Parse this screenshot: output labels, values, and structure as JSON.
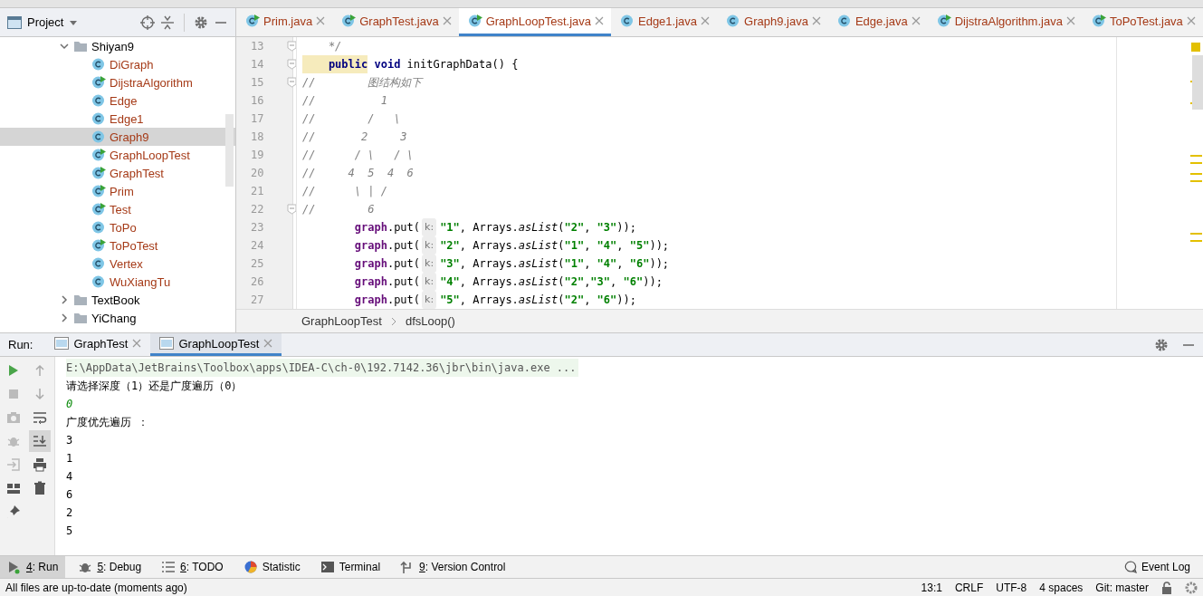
{
  "project_panel": {
    "title": "Project",
    "tree": [
      {
        "label": "Shiyan9",
        "kind": "folder",
        "expanded": true,
        "children": [
          {
            "label": "DiGraph",
            "kind": "class",
            "runnable": false,
            "selected": false
          },
          {
            "label": "DijstraAlgorithm",
            "kind": "class",
            "runnable": true,
            "selected": false
          },
          {
            "label": "Edge",
            "kind": "class",
            "runnable": false,
            "selected": false
          },
          {
            "label": "Edge1",
            "kind": "class",
            "runnable": false,
            "selected": false
          },
          {
            "label": "Graph9",
            "kind": "class",
            "runnable": false,
            "selected": true
          },
          {
            "label": "GraphLoopTest",
            "kind": "class",
            "runnable": true,
            "selected": false
          },
          {
            "label": "GraphTest",
            "kind": "class",
            "runnable": true,
            "selected": false
          },
          {
            "label": "Prim",
            "kind": "class",
            "runnable": true,
            "selected": false
          },
          {
            "label": "Test",
            "kind": "class",
            "runnable": true,
            "selected": false
          },
          {
            "label": "ToPo",
            "kind": "class",
            "runnable": false,
            "selected": false
          },
          {
            "label": "ToPoTest",
            "kind": "class",
            "runnable": true,
            "selected": false
          },
          {
            "label": "Vertex",
            "kind": "class",
            "runnable": false,
            "selected": false
          },
          {
            "label": "WuXiangTu",
            "kind": "class",
            "runnable": false,
            "selected": false
          }
        ]
      },
      {
        "label": "TextBook",
        "kind": "folder",
        "expanded": false
      },
      {
        "label": "YiChang",
        "kind": "folder",
        "expanded": false
      }
    ]
  },
  "editor": {
    "tabs": [
      {
        "label": "Prim.java",
        "runnable": true,
        "selected": false
      },
      {
        "label": "GraphTest.java",
        "runnable": true,
        "selected": false
      },
      {
        "label": "GraphLoopTest.java",
        "runnable": true,
        "selected": true
      },
      {
        "label": "Edge1.java",
        "runnable": false,
        "selected": false
      },
      {
        "label": "Graph9.java",
        "runnable": false,
        "selected": false
      },
      {
        "label": "Edge.java",
        "runnable": false,
        "selected": false
      },
      {
        "label": "DijstraAlgorithm.java",
        "runnable": true,
        "selected": false
      },
      {
        "label": "ToPoTest.java",
        "runnable": true,
        "selected": false
      }
    ],
    "lines": [
      {
        "number": "13",
        "fold": true,
        "tokens": [
          {
            "kind": "comment",
            "text": "    */"
          }
        ]
      },
      {
        "number": "14",
        "fold": true,
        "tokens": [
          {
            "kind": "keyword-highlight",
            "text": "    public"
          },
          {
            "kind": "keyword",
            "text": " void"
          },
          {
            "kind": "plain",
            "text": " initGraphData() {"
          }
        ]
      },
      {
        "number": "15",
        "fold": true,
        "tokens": [
          {
            "kind": "comment",
            "text": "//        图结构如下"
          }
        ]
      },
      {
        "number": "16",
        "fold": false,
        "tokens": [
          {
            "kind": "comment",
            "text": "//          1"
          }
        ]
      },
      {
        "number": "17",
        "fold": false,
        "tokens": [
          {
            "kind": "comment",
            "text": "//        /   \\"
          }
        ]
      },
      {
        "number": "18",
        "fold": false,
        "tokens": [
          {
            "kind": "comment",
            "text": "//       2     3"
          }
        ]
      },
      {
        "number": "19",
        "fold": false,
        "tokens": [
          {
            "kind": "comment",
            "text": "//      / \\   / \\"
          }
        ]
      },
      {
        "number": "20",
        "fold": false,
        "tokens": [
          {
            "kind": "comment",
            "text": "//     4  5  4  6"
          }
        ]
      },
      {
        "number": "21",
        "fold": false,
        "tokens": [
          {
            "kind": "comment",
            "text": "//      \\ | /"
          }
        ]
      },
      {
        "number": "22",
        "fold": true,
        "tokens": [
          {
            "kind": "comment",
            "text": "//        6"
          }
        ]
      },
      {
        "number": "23",
        "fold": false,
        "tokens": [
          {
            "kind": "field",
            "text": "        graph"
          },
          {
            "kind": "plain",
            "text": ".put("
          },
          {
            "kind": "hint",
            "text": "k:"
          },
          {
            "kind": "string",
            "text": "\"1\""
          },
          {
            "kind": "plain",
            "text": ", Arrays."
          },
          {
            "kind": "static",
            "text": "asList"
          },
          {
            "kind": "plain",
            "text": "("
          },
          {
            "kind": "string",
            "text": "\"2\""
          },
          {
            "kind": "plain",
            "text": ", "
          },
          {
            "kind": "string",
            "text": "\"3\""
          },
          {
            "kind": "plain",
            "text": "));"
          }
        ]
      },
      {
        "number": "24",
        "fold": false,
        "tokens": [
          {
            "kind": "field",
            "text": "        graph"
          },
          {
            "kind": "plain",
            "text": ".put("
          },
          {
            "kind": "hint",
            "text": "k:"
          },
          {
            "kind": "string",
            "text": "\"2\""
          },
          {
            "kind": "plain",
            "text": ", Arrays."
          },
          {
            "kind": "static",
            "text": "asList"
          },
          {
            "kind": "plain",
            "text": "("
          },
          {
            "kind": "string",
            "text": "\"1\""
          },
          {
            "kind": "plain",
            "text": ", "
          },
          {
            "kind": "string",
            "text": "\"4\""
          },
          {
            "kind": "plain",
            "text": ", "
          },
          {
            "kind": "string",
            "text": "\"5\""
          },
          {
            "kind": "plain",
            "text": "));"
          }
        ]
      },
      {
        "number": "25",
        "fold": false,
        "tokens": [
          {
            "kind": "field",
            "text": "        graph"
          },
          {
            "kind": "plain",
            "text": ".put("
          },
          {
            "kind": "hint",
            "text": "k:"
          },
          {
            "kind": "string",
            "text": "\"3\""
          },
          {
            "kind": "plain",
            "text": ", Arrays."
          },
          {
            "kind": "static",
            "text": "asList"
          },
          {
            "kind": "plain",
            "text": "("
          },
          {
            "kind": "string",
            "text": "\"1\""
          },
          {
            "kind": "plain",
            "text": ", "
          },
          {
            "kind": "string",
            "text": "\"4\""
          },
          {
            "kind": "plain",
            "text": ", "
          },
          {
            "kind": "string",
            "text": "\"6\""
          },
          {
            "kind": "plain",
            "text": "));"
          }
        ]
      },
      {
        "number": "26",
        "fold": false,
        "tokens": [
          {
            "kind": "field",
            "text": "        graph"
          },
          {
            "kind": "plain",
            "text": ".put("
          },
          {
            "kind": "hint",
            "text": "k:"
          },
          {
            "kind": "string",
            "text": "\"4\""
          },
          {
            "kind": "plain",
            "text": ", Arrays."
          },
          {
            "kind": "static",
            "text": "asList"
          },
          {
            "kind": "plain",
            "text": "("
          },
          {
            "kind": "string",
            "text": "\"2\""
          },
          {
            "kind": "plain",
            "text": ","
          },
          {
            "kind": "string",
            "text": "\"3\""
          },
          {
            "kind": "plain",
            "text": ", "
          },
          {
            "kind": "string",
            "text": "\"6\""
          },
          {
            "kind": "plain",
            "text": "));"
          }
        ]
      },
      {
        "number": "27",
        "fold": false,
        "tokens": [
          {
            "kind": "field",
            "text": "        graph"
          },
          {
            "kind": "plain",
            "text": ".put("
          },
          {
            "kind": "hint",
            "text": "k:"
          },
          {
            "kind": "string",
            "text": "\"5\""
          },
          {
            "kind": "plain",
            "text": ", Arrays."
          },
          {
            "kind": "static",
            "text": "asList"
          },
          {
            "kind": "plain",
            "text": "("
          },
          {
            "kind": "string",
            "text": "\"2\""
          },
          {
            "kind": "plain",
            "text": ", "
          },
          {
            "kind": "string",
            "text": "\"6\""
          },
          {
            "kind": "plain",
            "text": "));"
          }
        ]
      }
    ],
    "breadcrumb": [
      "GraphLoopTest",
      "dfsLoop()"
    ]
  },
  "run_panel": {
    "title": "Run:",
    "tabs": [
      {
        "label": "GraphTest",
        "selected": false
      },
      {
        "label": "GraphLoopTest",
        "selected": true
      }
    ],
    "console": [
      {
        "kind": "command",
        "text": "E:\\AppData\\JetBrains\\Toolbox\\apps\\IDEA-C\\ch-0\\192.7142.36\\jbr\\bin\\java.exe ..."
      },
      {
        "kind": "output",
        "text": "请选择深度（1）还是广度遍历（0）"
      },
      {
        "kind": "input",
        "text": "0"
      },
      {
        "kind": "output",
        "text": "广度优先遍历 ："
      },
      {
        "kind": "output",
        "text": "3"
      },
      {
        "kind": "output",
        "text": "1"
      },
      {
        "kind": "output",
        "text": "4"
      },
      {
        "kind": "output",
        "text": "6"
      },
      {
        "kind": "output",
        "text": "2"
      },
      {
        "kind": "output",
        "text": "5"
      }
    ]
  },
  "tool_windows": [
    {
      "key": "4",
      "label": ": Run",
      "selected": true
    },
    {
      "key": "5",
      "label": ": Debug",
      "selected": false
    },
    {
      "key": "6",
      "label": ": TODO",
      "selected": false
    },
    {
      "label": "Statistic",
      "selected": false
    },
    {
      "label": "Terminal",
      "selected": false
    },
    {
      "key": "9",
      "label": ": Version Control",
      "selected": false
    }
  ],
  "event_log": "Event Log",
  "status_bar": {
    "message": "All files are up-to-date (moments ago)",
    "items": [
      "13:1",
      "CRLF",
      "UTF-8",
      "4 spaces",
      "Git: master"
    ]
  }
}
